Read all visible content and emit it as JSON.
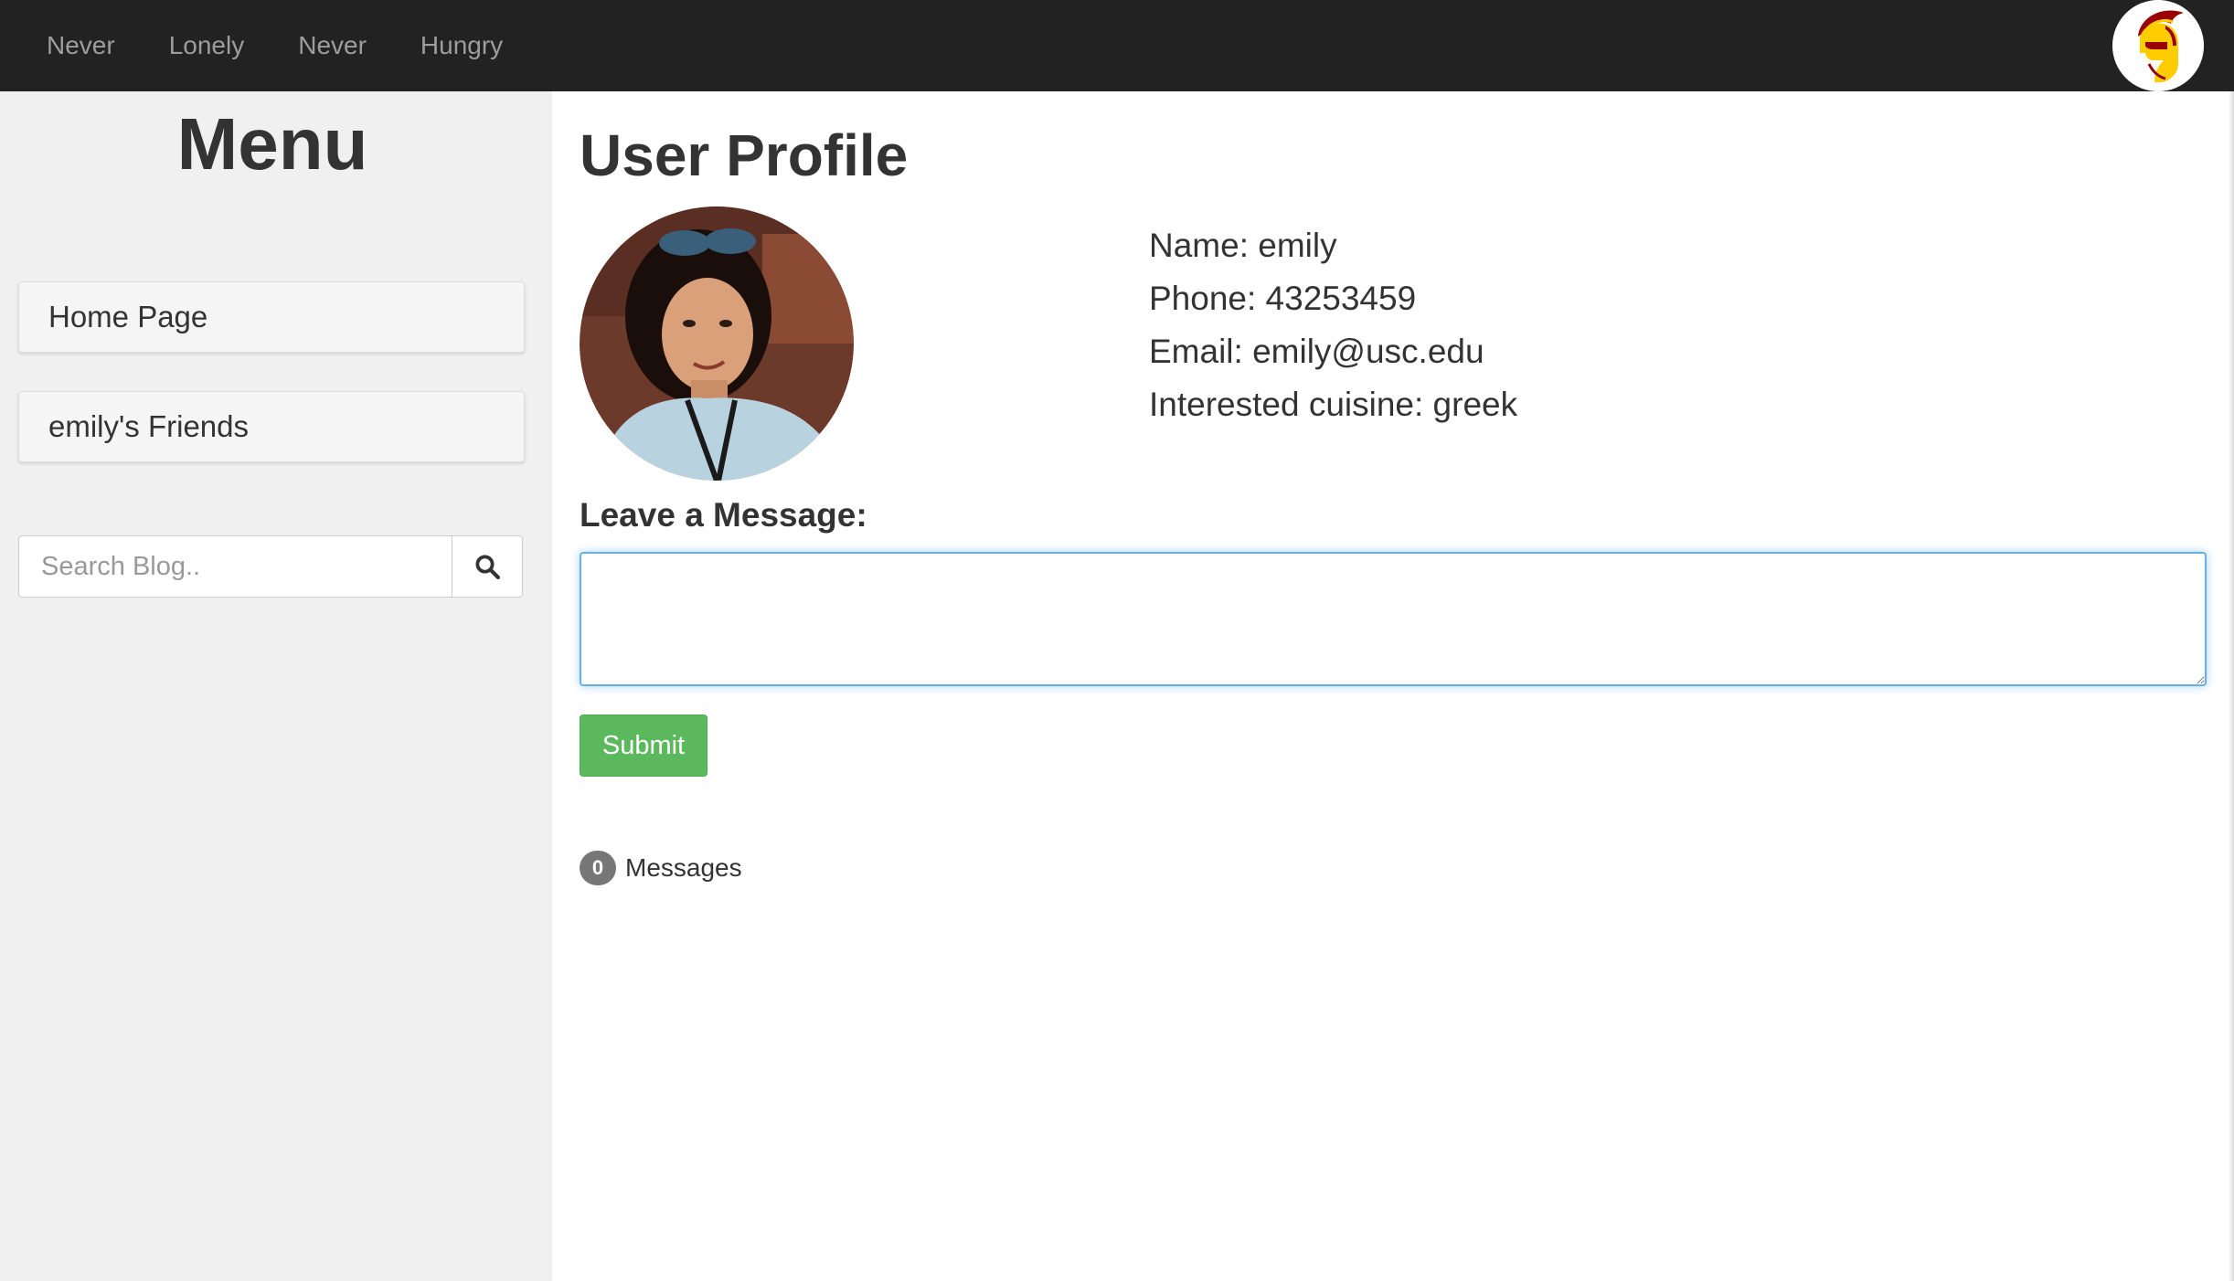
{
  "navbar": {
    "links": [
      "Never",
      "Lonely",
      "Never",
      "Hungry"
    ],
    "logo_icon": "trojan-helmet-logo-icon"
  },
  "sidebar": {
    "title": "Menu",
    "items": [
      {
        "label": "Home Page"
      },
      {
        "label": "emily's Friends"
      }
    ],
    "search": {
      "placeholder": "Search Blog..",
      "value": "",
      "button_icon": "search-icon"
    }
  },
  "main": {
    "title": "User Profile",
    "avatar_icon": "user-avatar-photo",
    "profile": {
      "name": "Name: emily",
      "phone": "Phone: 43253459",
      "email": "Email: emily@usc.edu",
      "cuisine": "Interested cuisine: greek"
    },
    "message_label": "Leave a Message:",
    "message_value": "",
    "submit_label": "Submit",
    "messages_count": "0",
    "messages_label": "Messages"
  },
  "colors": {
    "navbar_bg": "#222222",
    "nav_text": "#9d9d9d",
    "sidebar_bg": "#f0f0f0",
    "submit_green": "#5cb85c",
    "focus_blue": "#66afe9",
    "badge_gray": "#777777",
    "logo_red": "#990000",
    "logo_gold": "#ffcc00"
  }
}
